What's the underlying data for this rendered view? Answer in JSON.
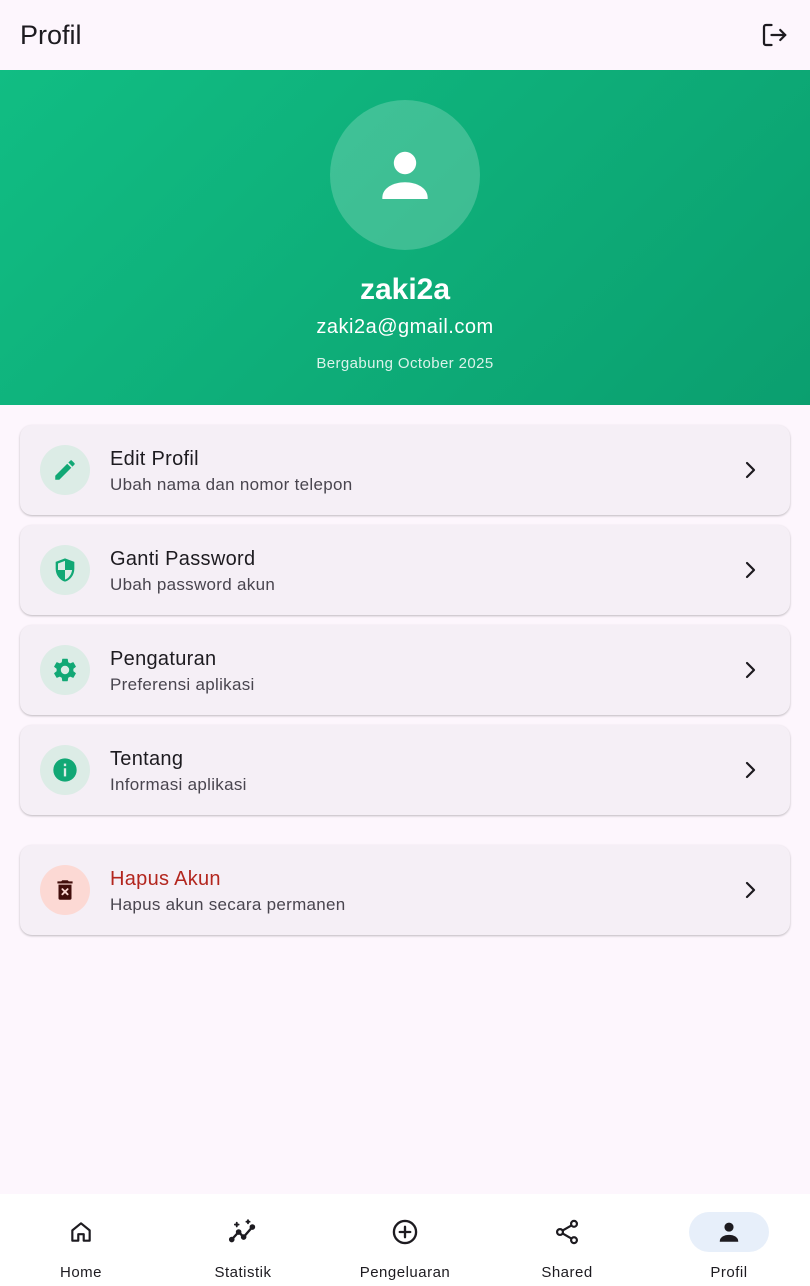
{
  "appbar": {
    "title": "Profil",
    "logout_icon": "logout-icon"
  },
  "profile": {
    "avatar_icon": "person-icon",
    "name": "zaki2a",
    "email": "zaki2a@gmail.com",
    "joined": "Bergabung October 2025"
  },
  "menu": {
    "edit": {
      "title": "Edit Profil",
      "subtitle": "Ubah nama dan nomor telepon",
      "icon": "pencil-icon"
    },
    "password": {
      "title": "Ganti Password",
      "subtitle": "Ubah password akun",
      "icon": "shield-icon"
    },
    "settings": {
      "title": "Pengaturan",
      "subtitle": "Preferensi aplikasi",
      "icon": "gear-icon"
    },
    "about": {
      "title": "Tentang",
      "subtitle": "Informasi aplikasi",
      "icon": "info-icon"
    },
    "delete": {
      "title": "Hapus Akun",
      "subtitle": "Hapus akun secara permanen",
      "icon": "trash-icon"
    }
  },
  "nav": {
    "home": "Home",
    "stats": "Statistik",
    "expense": "Pengeluaran",
    "shared": "Shared",
    "profile": "Profil"
  },
  "colors": {
    "accent": "#11bd83",
    "danger": "#b3261e",
    "background": "#fdf6fd"
  }
}
